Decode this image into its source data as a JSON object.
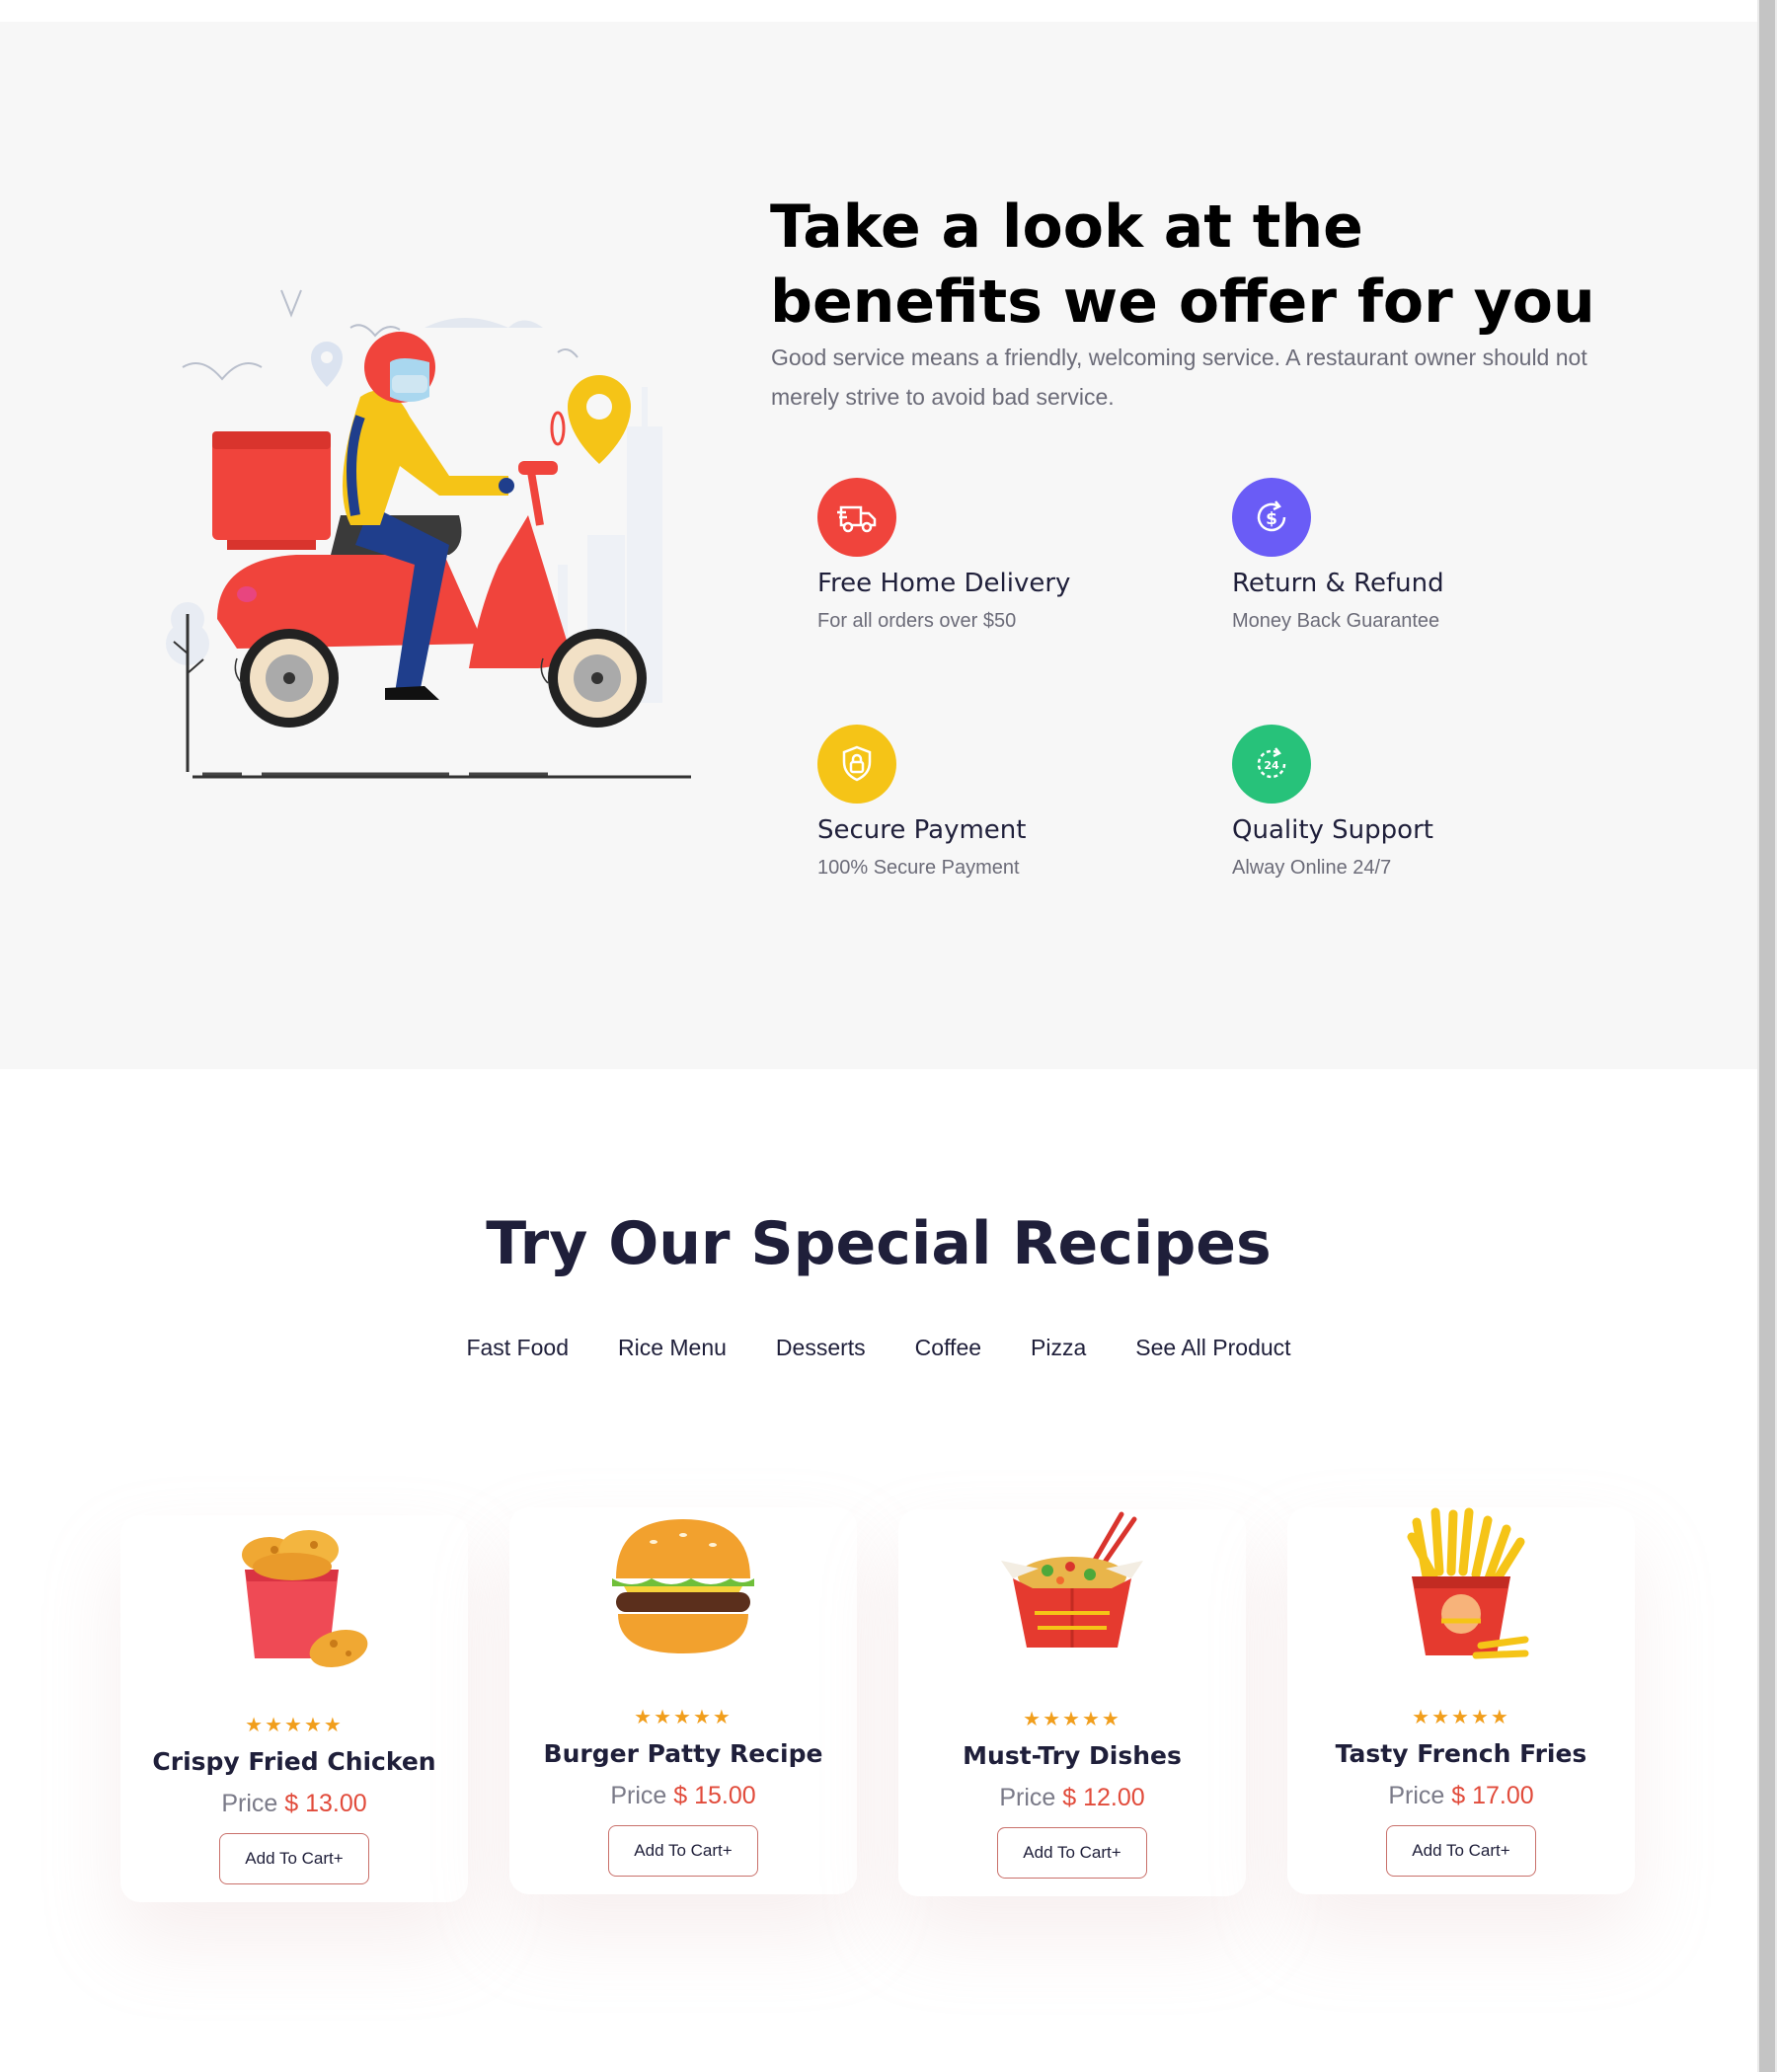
{
  "benefits": {
    "title_line1": "Take a look at the",
    "title_line2": "benefits we offer for you",
    "description": "Good service means a friendly, welcoming service. A restaurant owner should not merely strive to avoid bad service.",
    "features": [
      {
        "title": "Free Home Delivery",
        "subtitle": "For all orders over $50",
        "icon": "delivery-truck-icon",
        "color": "#f0443c"
      },
      {
        "title": "Return & Refund",
        "subtitle": "Money Back Guarantee",
        "icon": "refund-icon",
        "color": "#6a5cf6"
      },
      {
        "title": "Secure Payment",
        "subtitle": "100% Secure Payment",
        "icon": "shield-lock-icon",
        "color": "#f5c417"
      },
      {
        "title": "Quality Support",
        "subtitle": "Alway Online 24/7",
        "icon": "support-24-icon",
        "color": "#27c27a"
      }
    ]
  },
  "recipes": {
    "title": "Try Our Special Recipes",
    "tabs": [
      "Fast Food",
      "Rice Menu",
      "Desserts",
      "Coffee",
      "Pizza",
      "See All Product"
    ],
    "products": [
      {
        "name": "Crispy Fried Chicken",
        "price_label": "Price",
        "price": "$ 13.00",
        "rating": 5,
        "button": "Add To Cart+"
      },
      {
        "name": "Burger Patty Recipe",
        "price_label": "Price",
        "price": "$ 15.00",
        "rating": 5,
        "button": "Add To Cart+"
      },
      {
        "name": "Must-Try Dishes",
        "price_label": "Price",
        "price": "$ 12.00",
        "rating": 5,
        "button": "Add To Cart+"
      },
      {
        "name": "Tasty French Fries",
        "price_label": "Price",
        "price": "$ 17.00",
        "rating": 5,
        "button": "Add To Cart+"
      }
    ]
  },
  "colors": {
    "accent": "#e14b3b",
    "star": "#f19e1c",
    "heading": "#1f1f3a"
  }
}
